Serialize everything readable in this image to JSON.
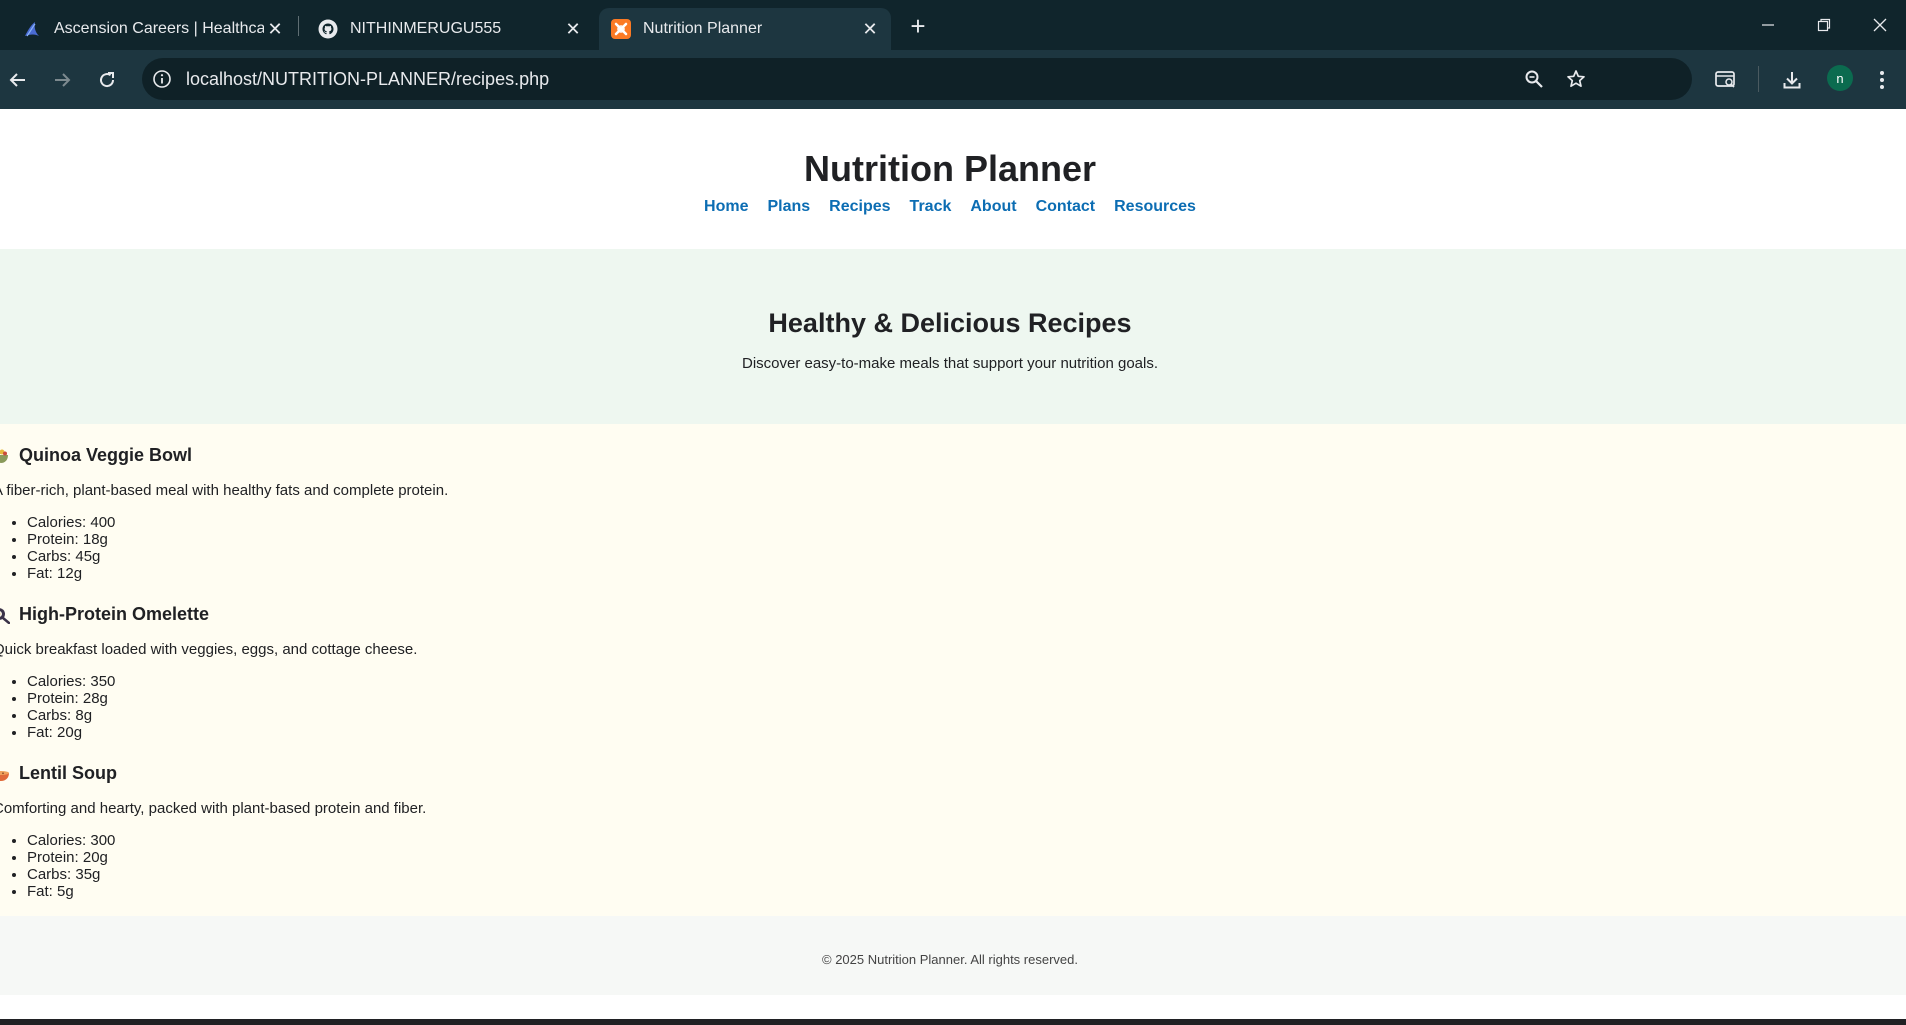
{
  "browser": {
    "tabs": [
      {
        "title": "Ascension Careers | Healthcare",
        "icon": "ascension-logo-icon",
        "active": false
      },
      {
        "title": "NITHINMERUGU555",
        "icon": "github-icon",
        "active": false
      },
      {
        "title": "Nutrition Planner",
        "icon": "xampp-icon",
        "active": true
      }
    ],
    "url": "localhost/NUTRITION-PLANNER/recipes.php",
    "profile_initial": "n"
  },
  "site": {
    "title": "Nutrition Planner",
    "nav": [
      "Home",
      "Plans",
      "Recipes",
      "Track",
      "About",
      "Contact",
      "Resources"
    ],
    "hero": {
      "heading": "Healthy & Delicious Recipes",
      "subtext": "Discover easy-to-make meals that support your nutrition goals."
    },
    "recipes": [
      {
        "name": "Quinoa Veggie Bowl",
        "description": "A fiber-rich, plant-based meal with healthy fats and complete protein.",
        "calories": "Calories: 400",
        "protein": "Protein: 18g",
        "carbs": "Carbs: 45g",
        "fat": "Fat: 12g"
      },
      {
        "name": "High-Protein Omelette",
        "description": "Quick breakfast loaded with veggies, eggs, and cottage cheese.",
        "calories": "Calories: 350",
        "protein": "Protein: 28g",
        "carbs": "Carbs: 8g",
        "fat": "Fat: 20g"
      },
      {
        "name": "Lentil Soup",
        "description": "Comforting and hearty, packed with plant-based protein and fiber.",
        "calories": "Calories: 300",
        "protein": "Protein: 20g",
        "carbs": "Carbs: 35g",
        "fat": "Fat: 5g"
      }
    ],
    "footer": "© 2025 Nutrition Planner. All rights reserved."
  },
  "colors": {
    "chrome_bg": "#10252c",
    "toolbar_bg": "#1d3640",
    "nav_link": "#0c6db3",
    "hero_bg": "#eef7f0",
    "recipes_bg": "#fffdf2",
    "footer_bg": "#f6f8f6"
  }
}
